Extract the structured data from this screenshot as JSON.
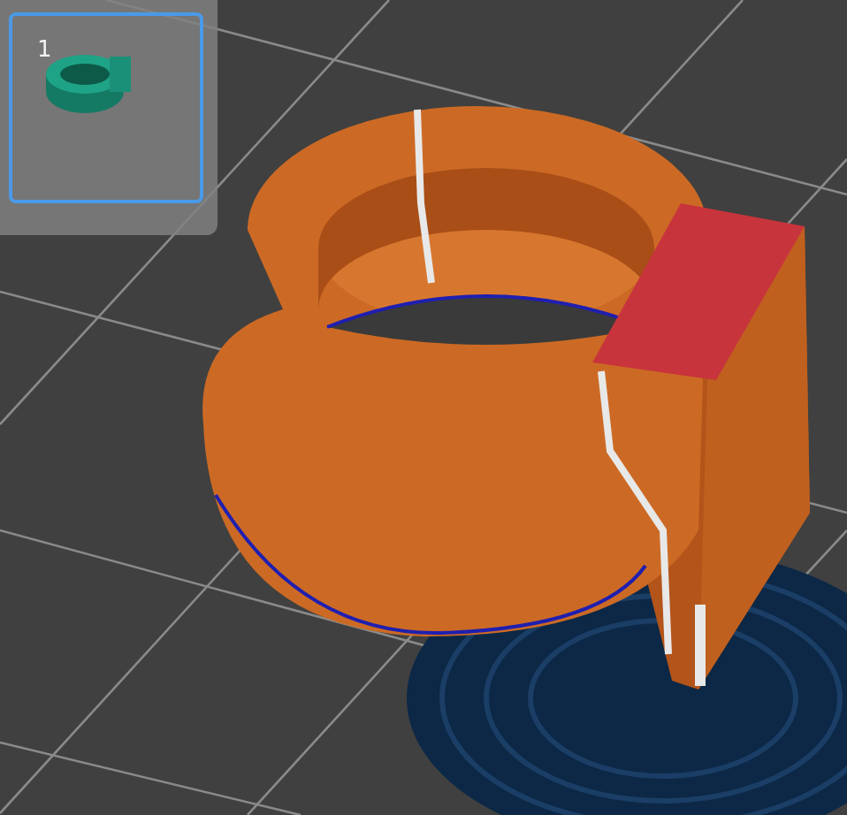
{
  "objects": [
    {
      "label": "1",
      "selected": true
    }
  ]
}
